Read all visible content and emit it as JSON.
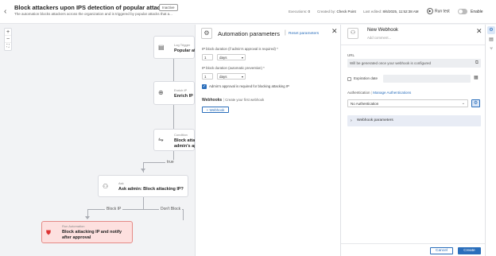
{
  "header": {
    "back_icon": "‹",
    "title": "Block attackers upon IPS detection of popular attacks",
    "status_badge": "Inactive",
    "description": "The automation blocks attackers across the organization and is triggered by popular attacks that a...",
    "executions_label": "Executions:",
    "executions_value": "0",
    "created_by_label": "Created by:",
    "created_by_value": "Check Point",
    "last_edited_label": "Last edited:",
    "last_edited_value": "8/6/2025, 11:52:38 AM",
    "run_test_label": "Run test",
    "enable_label": "Enable"
  },
  "canvas": {
    "zoom_in": "+",
    "zoom_out": "−",
    "fit": "⛶",
    "nodes": [
      {
        "label": "Log Trigger",
        "name": "Popular att",
        "icon": "log-icon"
      },
      {
        "label": "Enrich IP",
        "name": "Enrich IP",
        "icon": "enrich-icon"
      },
      {
        "label": "Condition",
        "name": "Block attack",
        "name2": "admin's app",
        "icon": "condition-icon"
      },
      {
        "label": "Ask",
        "name": "Ask admin: Block attacking IP?",
        "icon": "ask-icon"
      },
      {
        "label": "Run Automation",
        "name": "Block attacking IP and notify",
        "name2": "after approval",
        "icon": "shield-icon"
      }
    ],
    "edge_true": "true",
    "edge_block": "Block IP",
    "edge_dont_block": "Don't Block"
  },
  "params": {
    "title": "Automation parameters",
    "reset": "Reset parameters",
    "field1_label": "IP block duration (if admin's approval is required) *",
    "field1_value": "1",
    "field1_unit": "days",
    "field2_label": "IP block duration (automatic prevention) *",
    "field2_value": "1",
    "field2_unit": "days",
    "approval_label": "Admin's approval is required for blocking attacking IP",
    "webhooks_title": "Webhooks",
    "webhooks_sub": "Create your first webhook",
    "add_webhook": "+ Webhook"
  },
  "webhook": {
    "title": "New Webhook",
    "subtitle": "Add comment...",
    "url_label": "URL",
    "url_placeholder": "Will be generated once your webhook is configured",
    "expiration_label": "Expiration date",
    "auth_label": "Authentication",
    "auth_link": "Manage Authentications",
    "auth_value": "No Authentication",
    "params_label": "Webhook parameters",
    "cancel": "Cancel",
    "create": "Create"
  }
}
